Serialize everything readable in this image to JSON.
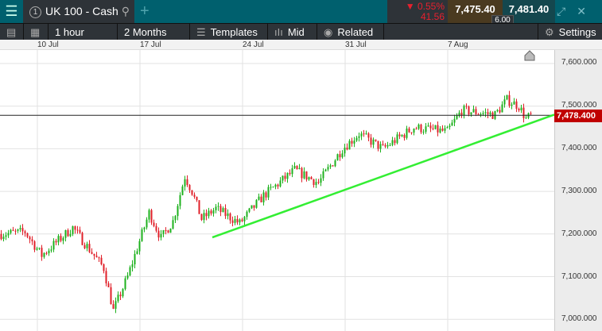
{
  "header": {
    "menu_icon": "hamburger-icon",
    "tab_number": "1",
    "instrument": "UK 100 - Cash",
    "add": "+",
    "change_pct": "0.55%",
    "change_abs": "41.56",
    "sell": "7,475.40",
    "buy": "7,481.40",
    "spread": "6.00",
    "expand": "⤢",
    "close": "✕"
  },
  "toolbar": {
    "interval": "1 hour",
    "range": "2 Months",
    "templates": "Templates",
    "price_type": "Mid",
    "related": "Related",
    "settings": "Settings"
  },
  "dates": [
    "10 Jul",
    "17 Jul",
    "24 Jul",
    "31 Jul",
    "7 Aug"
  ],
  "y_labels": [
    "7,600.000",
    "7,500.000",
    "7,400.000",
    "7,300.000",
    "7,200.000",
    "7,100.000",
    "7,000.000"
  ],
  "current_price": "7,478.400",
  "colors": {
    "up": "#1db11d",
    "down": "#e0202a",
    "trendline": "#33ee33"
  },
  "chart_data": {
    "type": "candlestick",
    "ylim": [
      6995,
      7625
    ],
    "candles": 230,
    "keyframes": [
      [
        0,
        7200
      ],
      [
        10,
        7205
      ],
      [
        17,
        7150
      ],
      [
        30,
        7215
      ],
      [
        43,
        7120
      ],
      [
        47,
        7020
      ],
      [
        53,
        7100
      ],
      [
        62,
        7250
      ],
      [
        67,
        7190
      ],
      [
        72,
        7230
      ],
      [
        77,
        7335
      ],
      [
        80,
        7300
      ],
      [
        84,
        7235
      ],
      [
        90,
        7260
      ],
      [
        100,
        7225
      ],
      [
        110,
        7290
      ],
      [
        123,
        7350
      ],
      [
        133,
        7320
      ],
      [
        143,
        7400
      ],
      [
        150,
        7435
      ],
      [
        160,
        7400
      ],
      [
        173,
        7450
      ],
      [
        187,
        7440
      ],
      [
        193,
        7490
      ],
      [
        207,
        7480
      ],
      [
        212,
        7515
      ],
      [
        217,
        7500
      ],
      [
        220,
        7470
      ],
      [
        222,
        7478
      ]
    ],
    "trendline": [
      [
        89,
        7192
      ],
      [
        232,
        7480
      ]
    ]
  }
}
